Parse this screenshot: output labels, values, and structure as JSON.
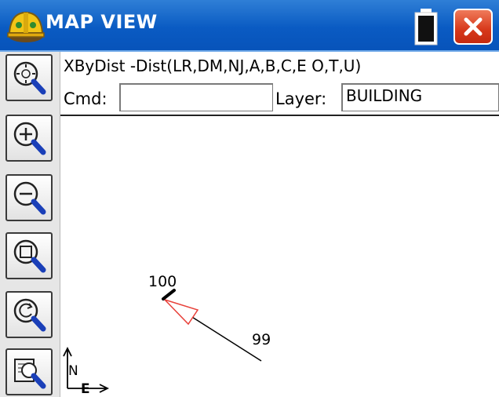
{
  "window": {
    "title": "MAP VIEW",
    "icons": {
      "app": "hardhat-icon",
      "battery": "battery-icon",
      "close": "close-icon"
    },
    "colors": {
      "titlebar": "#0a5bc3",
      "close": "#d6381a"
    }
  },
  "toolbar": {
    "buttons": [
      {
        "name": "zoom-extents-button",
        "icon": "zoom-extents-icon"
      },
      {
        "name": "zoom-in-button",
        "icon": "zoom-in-icon"
      },
      {
        "name": "zoom-out-button",
        "icon": "zoom-out-icon"
      },
      {
        "name": "zoom-window-button",
        "icon": "zoom-window-icon"
      },
      {
        "name": "zoom-previous-button",
        "icon": "zoom-previous-icon"
      },
      {
        "name": "map-options-button",
        "icon": "map-options-icon"
      }
    ]
  },
  "command": {
    "help_text": "XByDist -Dist(LR,DM,NJ,A,B,C,E O,T,U)",
    "cmd_label": "Cmd:",
    "cmd_value": "",
    "layer_label": "Layer:",
    "layer_value": "BUILDING"
  },
  "map": {
    "points": [
      {
        "label": "100"
      },
      {
        "label": "99"
      }
    ],
    "north_label": "N",
    "east_label": "E",
    "colors": {
      "line": "#000000",
      "arrow": "#e8413a"
    }
  }
}
